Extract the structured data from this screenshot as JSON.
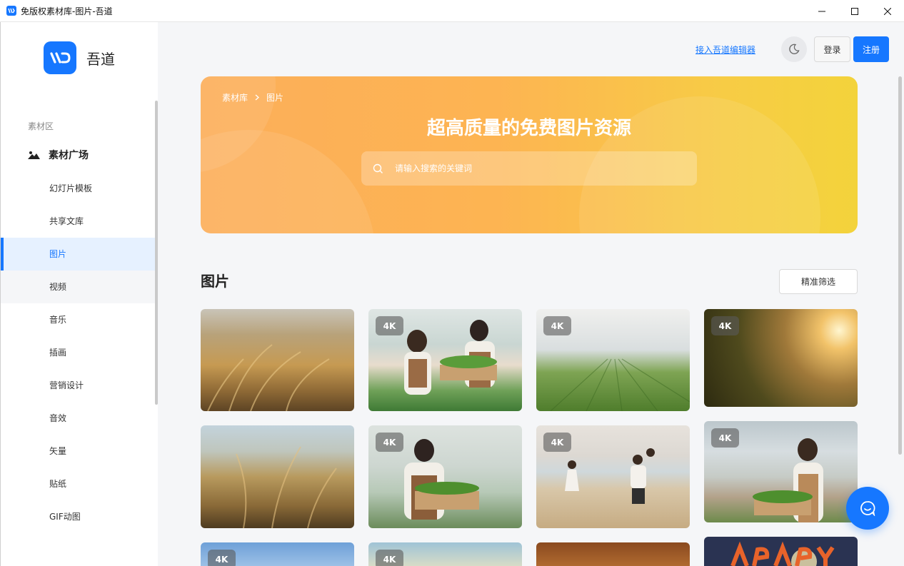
{
  "window": {
    "title": "免版权素材库-图片-吾道"
  },
  "brand": {
    "name": "吾道",
    "color": "#1677ff"
  },
  "sidebar": {
    "section_title": "素材区",
    "group_title": "素材广场",
    "items": [
      {
        "label": "幻灯片模板"
      },
      {
        "label": "共享文库"
      },
      {
        "label": "图片"
      },
      {
        "label": "视频"
      },
      {
        "label": "音乐"
      },
      {
        "label": "插画"
      },
      {
        "label": "营销设计"
      },
      {
        "label": "音效"
      },
      {
        "label": "矢量"
      },
      {
        "label": "贴纸"
      },
      {
        "label": "GIF动图"
      }
    ]
  },
  "header": {
    "editor_link": "接入吾道编辑器",
    "login": "登录",
    "register": "注册"
  },
  "banner": {
    "breadcrumb": [
      "素材库",
      "图片"
    ],
    "title": "超高质量的免费图片资源",
    "search_placeholder": "请输入搜索的关键词"
  },
  "content": {
    "heading": "图片",
    "filter_button": "精准筛选",
    "badge_label": "4K"
  }
}
